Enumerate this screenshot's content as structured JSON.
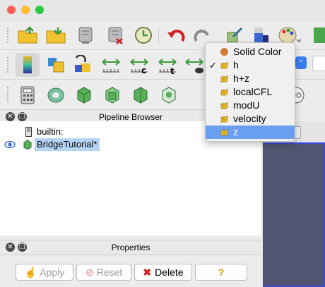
{
  "pipeline_browser": {
    "title": "Pipeline Browser",
    "items": [
      {
        "label": "builtin:"
      },
      {
        "label": "BridgeTutorial*"
      }
    ]
  },
  "properties": {
    "title": "Properties",
    "apply_label": "Apply",
    "reset_label": "Reset",
    "delete_label": "Delete",
    "help_label": "?"
  },
  "coloring_menu": {
    "items": [
      {
        "label": "Solid Color",
        "icon": "solid-color-dot-icon",
        "checked": false,
        "selected": false
      },
      {
        "label": "h",
        "icon": "cell-data-icon",
        "checked": true,
        "selected": false
      },
      {
        "label": "h+z",
        "icon": "cell-data-icon",
        "checked": false,
        "selected": false
      },
      {
        "label": "localCFL",
        "icon": "cell-data-icon",
        "checked": false,
        "selected": false
      },
      {
        "label": "modU",
        "icon": "cell-data-icon",
        "checked": false,
        "selected": false
      },
      {
        "label": "velocity",
        "icon": "cell-data-icon",
        "checked": false,
        "selected": false
      },
      {
        "label": "z",
        "icon": "cell-data-icon",
        "checked": false,
        "selected": true
      }
    ],
    "check_mark": "✓"
  },
  "colors": {
    "selection": "#6a9ff0",
    "render_background": "#525571",
    "solid_color_dot": "#d07a3a",
    "data_icon": "#f0c030"
  }
}
